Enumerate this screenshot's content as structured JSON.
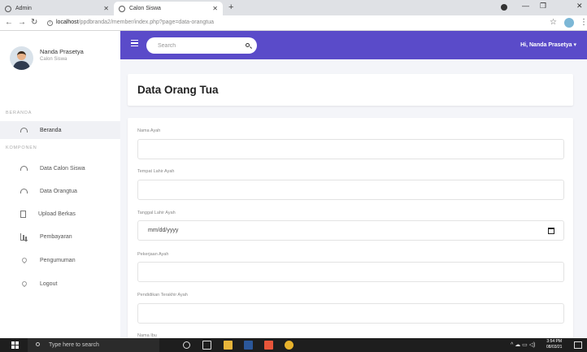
{
  "browser": {
    "tabs": [
      {
        "label": "Admin"
      },
      {
        "label": "Calon Siswa"
      }
    ],
    "url_host": "localhost",
    "url_path": "/ppdbranda2/member/index.php?page=data-orangtua"
  },
  "sidebar": {
    "user_name": "Nanda Prasetya",
    "user_role": "Calon Siswa",
    "section_home": "BERANDA",
    "section_components": "KOMPONEN",
    "items": [
      {
        "label": "Beranda",
        "icon": "dashboard-icon"
      },
      {
        "label": "Data Calon Siswa",
        "icon": "dashboard-icon"
      },
      {
        "label": "Data Orangtua",
        "icon": "dashboard-icon"
      },
      {
        "label": "Upload Berkas",
        "icon": "document-icon"
      },
      {
        "label": "Pembayaran",
        "icon": "bar-chart-icon"
      },
      {
        "label": "Pengumuman",
        "icon": "pin-icon"
      },
      {
        "label": "Logout",
        "icon": "pin-icon"
      }
    ]
  },
  "topbar": {
    "search_placeholder": "Search",
    "greeting": "Hi, Nanda Prasetya ▾",
    "color": "#5a4bc9"
  },
  "page": {
    "title": "Data Orang Tua"
  },
  "form": {
    "fields": [
      {
        "label": "Nama Ayah",
        "value": ""
      },
      {
        "label": "Tempat Lahir Ayah",
        "value": ""
      },
      {
        "label": "Tanggal Lahir Ayah",
        "value": "mm/dd/yyyy"
      },
      {
        "label": "Pekerjaan Ayah",
        "value": ""
      },
      {
        "label": "Pendidikan Terakhir Ayah",
        "value": ""
      },
      {
        "label": "Nama Ibu",
        "value": ""
      }
    ]
  },
  "taskbar": {
    "search_text": "Type here to search",
    "time": "3:54 PM",
    "date": "08/03/21"
  }
}
